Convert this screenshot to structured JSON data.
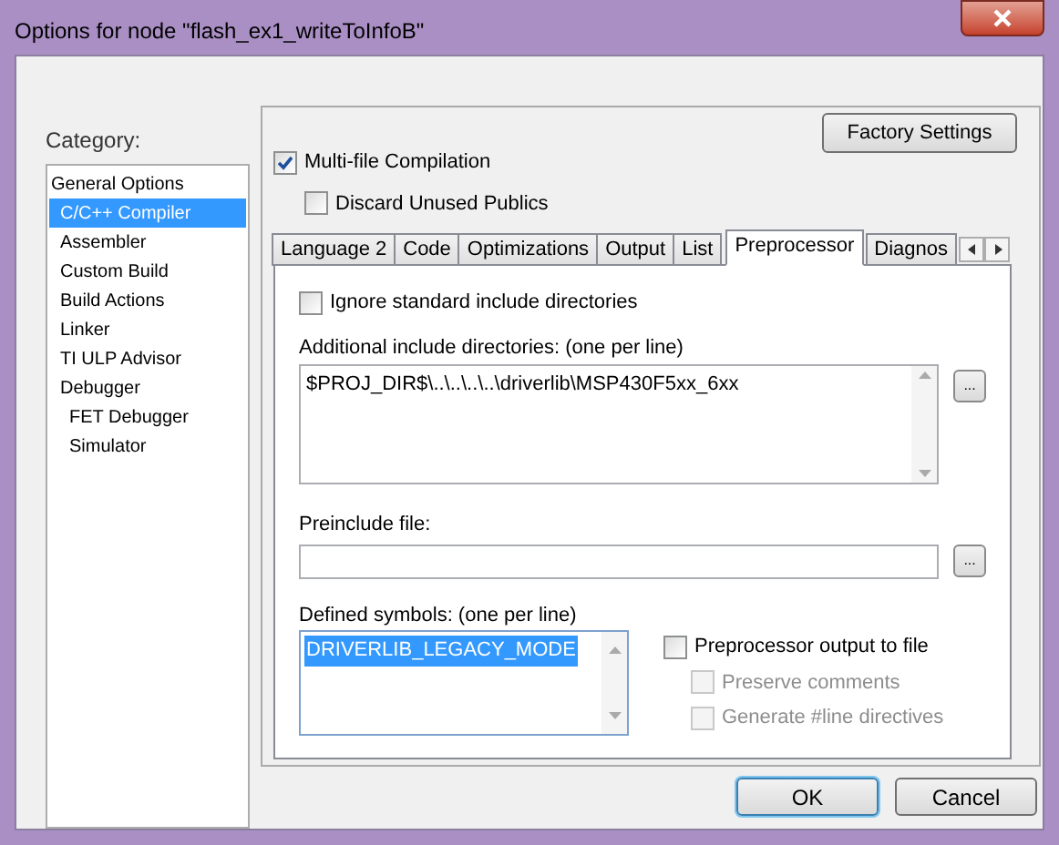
{
  "window": {
    "title": "Options for node \"flash_ex1_writeToInfoB\""
  },
  "category": {
    "label": "Category:",
    "items": [
      {
        "label": "General Options",
        "selected": false
      },
      {
        "label": "C/C++ Compiler",
        "selected": true
      },
      {
        "label": "Assembler",
        "selected": false
      },
      {
        "label": "Custom Build",
        "selected": false
      },
      {
        "label": "Build Actions",
        "selected": false
      },
      {
        "label": "Linker",
        "selected": false
      },
      {
        "label": "TI ULP Advisor",
        "selected": false
      },
      {
        "label": "Debugger",
        "selected": false,
        "children": [
          {
            "label": "FET Debugger",
            "selected": false
          },
          {
            "label": "Simulator",
            "selected": false
          }
        ]
      }
    ]
  },
  "factory_button": "Factory Settings",
  "top_options": [
    {
      "label": "Multi-file Compilation",
      "checked": true,
      "disabled": false
    },
    {
      "label": "Discard Unused Publics",
      "checked": false,
      "disabled": false
    }
  ],
  "tabs": [
    {
      "label": "Language 2",
      "selected": false
    },
    {
      "label": "Code",
      "selected": false
    },
    {
      "label": "Optimizations",
      "selected": false
    },
    {
      "label": "Output",
      "selected": false
    },
    {
      "label": "List",
      "selected": false
    },
    {
      "label": "Preprocessor",
      "selected": true
    },
    {
      "label": "Diagnos",
      "selected": false
    }
  ],
  "ignore_std": {
    "label": "Ignore standard include directories",
    "checked": false
  },
  "include_dirs": {
    "label": "Additional include directories: (one per line)",
    "value": "$PROJ_DIR$\\..\\..\\..\\..\\driverlib\\MSP430F5xx_6xx",
    "browse": "..."
  },
  "preinclude": {
    "label": "Preinclude file:",
    "browse": "..."
  },
  "defined_symbols": {
    "label": "Defined symbols: (one per line)",
    "value": "DRIVERLIB_LEGACY_MODE",
    "value_selected": true
  },
  "preprocessor_output": [
    {
      "label": "Preprocessor output to file",
      "checked": false,
      "disabled": false
    },
    {
      "label": "Preserve comments",
      "checked": false,
      "disabled": true
    },
    {
      "label": "Generate #line directives",
      "checked": false,
      "disabled": true
    }
  ],
  "buttons": [
    {
      "label": "OK",
      "default": true
    },
    {
      "label": "Cancel",
      "default": false
    }
  ]
}
